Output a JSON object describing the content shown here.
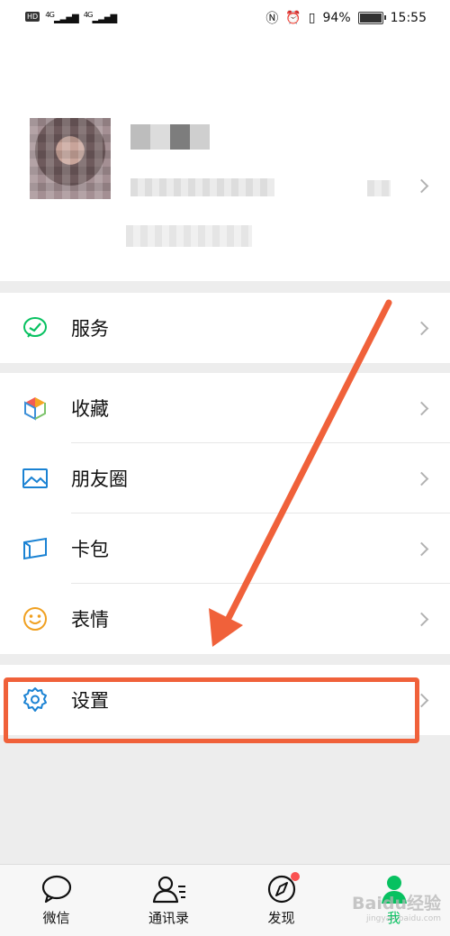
{
  "status_bar": {
    "signal_1": "4G",
    "signal_2": "4G",
    "battery_percent": "94%",
    "battery_level": 0.94,
    "time": "15:55",
    "hd_badge": "HD"
  },
  "menu": {
    "services": {
      "label": "服务",
      "icon": "services-icon"
    },
    "favorites": {
      "label": "收藏",
      "icon": "favorites-cube-icon"
    },
    "moments": {
      "label": "朋友圈",
      "icon": "moments-image-icon"
    },
    "cards": {
      "label": "卡包",
      "icon": "card-wallet-icon"
    },
    "stickers": {
      "label": "表情",
      "icon": "smiley-icon"
    },
    "settings": {
      "label": "设置",
      "icon": "gear-icon"
    }
  },
  "tabbar": {
    "tabs": [
      {
        "label": "微信",
        "icon": "chat-bubble-icon",
        "active": false
      },
      {
        "label": "通讯录",
        "icon": "contacts-icon",
        "active": false
      },
      {
        "label": "发现",
        "icon": "compass-icon",
        "active": false,
        "badge": true
      },
      {
        "label": "我",
        "icon": "person-icon",
        "active": true
      }
    ]
  },
  "watermark": {
    "text": "Baidu经验",
    "sub": "jingyan.baidu.com"
  },
  "colors": {
    "accent_green": "#07c160",
    "annotation": "#f0613a",
    "badge_red": "#fa5151",
    "icon_blue": "#1a82d3"
  }
}
